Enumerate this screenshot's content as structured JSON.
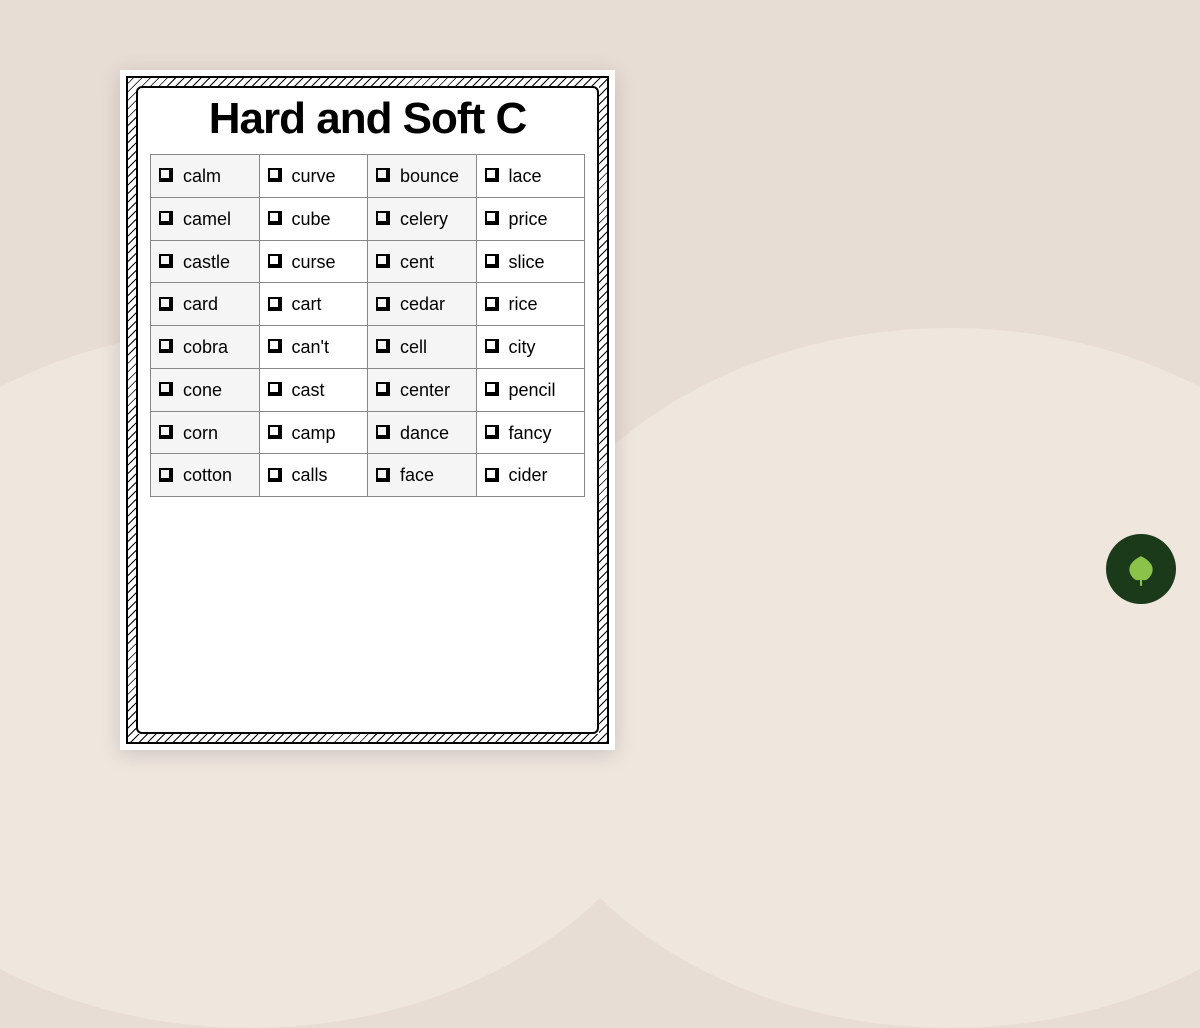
{
  "title": "Hard and Soft C",
  "columns": [
    [
      "calm",
      "camel",
      "castle",
      "card",
      "cobra",
      "cone",
      "corn",
      "cotton"
    ],
    [
      "curve",
      "cube",
      "curse",
      "cart",
      "can't",
      "cast",
      "camp",
      "calls"
    ],
    [
      "bounce",
      "celery",
      "cent",
      "cedar",
      "cell",
      "center",
      "dance",
      "face"
    ],
    [
      "lace",
      "price",
      "slice",
      "rice",
      "city",
      "pencil",
      "fancy",
      "cider"
    ]
  ],
  "logo_color": "#8bc34a"
}
